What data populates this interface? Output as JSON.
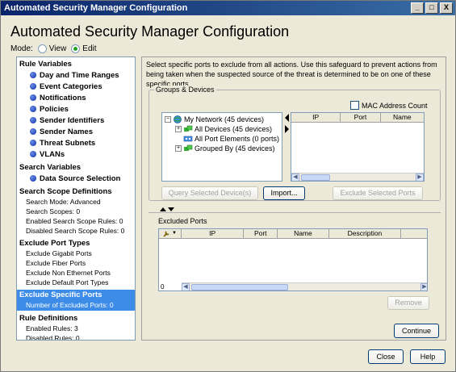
{
  "window": {
    "title": "Automated Security Manager Configuration",
    "controls": [
      "_",
      "□",
      "X"
    ]
  },
  "heading": "Automated Security Manager Configuration",
  "mode": {
    "label": "Mode:",
    "options": [
      {
        "label": "View",
        "selected": false
      },
      {
        "label": "Edit",
        "selected": true
      }
    ]
  },
  "sidebar": {
    "rule_variables_header": "Rule Variables",
    "rule_variables": [
      "Day and Time Ranges",
      "Event Categories",
      "Notifications",
      "Policies",
      "Sender Identifiers",
      "Sender Names",
      "Threat Subnets",
      "VLANs"
    ],
    "search_variables_header": "Search Variables",
    "search_variables": [
      "Data Source Selection"
    ],
    "scope_header": "Search Scope Definitions",
    "scope_items": [
      "Search Mode: Advanced",
      "Search Scopes: 0",
      "Enabled Search Scope Rules: 0",
      "Disabled Search Scope Rules: 0"
    ],
    "exclude_port_types_header": "Exclude Port Types",
    "exclude_port_types": [
      "Exclude Gigabit Ports",
      "Exclude Fiber Ports",
      "Exclude Non Ethernet Ports",
      "Exclude Default Port Types"
    ],
    "exclude_specific_header": "Exclude Specific Ports",
    "exclude_specific_item": "Number of Excluded Ports: 0",
    "rule_defs_header": "Rule Definitions",
    "rule_defs": [
      "Enabled Rules: 3",
      "Disabled Rules: 0"
    ]
  },
  "main": {
    "intro": "Select specific ports to exclude from all actions.  Use this safeguard to prevent actions from being taken when the suspected source of the threat is determined to be on one of these specific ports.",
    "groups_title": "Groups & Devices",
    "mac_count_label": "MAC Address Count",
    "tree": [
      {
        "label": "My Network (45 devices)",
        "level": 0,
        "expander": "−"
      },
      {
        "label": "All Devices (45 devices)",
        "level": 1,
        "expander": "+"
      },
      {
        "label": "All Port Elements (0 ports)",
        "level": 1,
        "expander": ""
      },
      {
        "label": "Grouped By (45 devices)",
        "level": 1,
        "expander": "+"
      }
    ],
    "device_columns": [
      "IP",
      "Port",
      "Name"
    ],
    "query_button": "Query Selected Device(s)",
    "import_button": "Import...",
    "exclude_button": "Exclude Selected Ports",
    "excluded_title": "Excluded Ports",
    "excluded_columns": [
      "IP",
      "Port",
      "Name",
      "Description"
    ],
    "row_count": "0",
    "remove_button": "Remove",
    "continue_button": "Continue"
  },
  "footer": {
    "close_button": "Close",
    "help_button": "Help"
  }
}
